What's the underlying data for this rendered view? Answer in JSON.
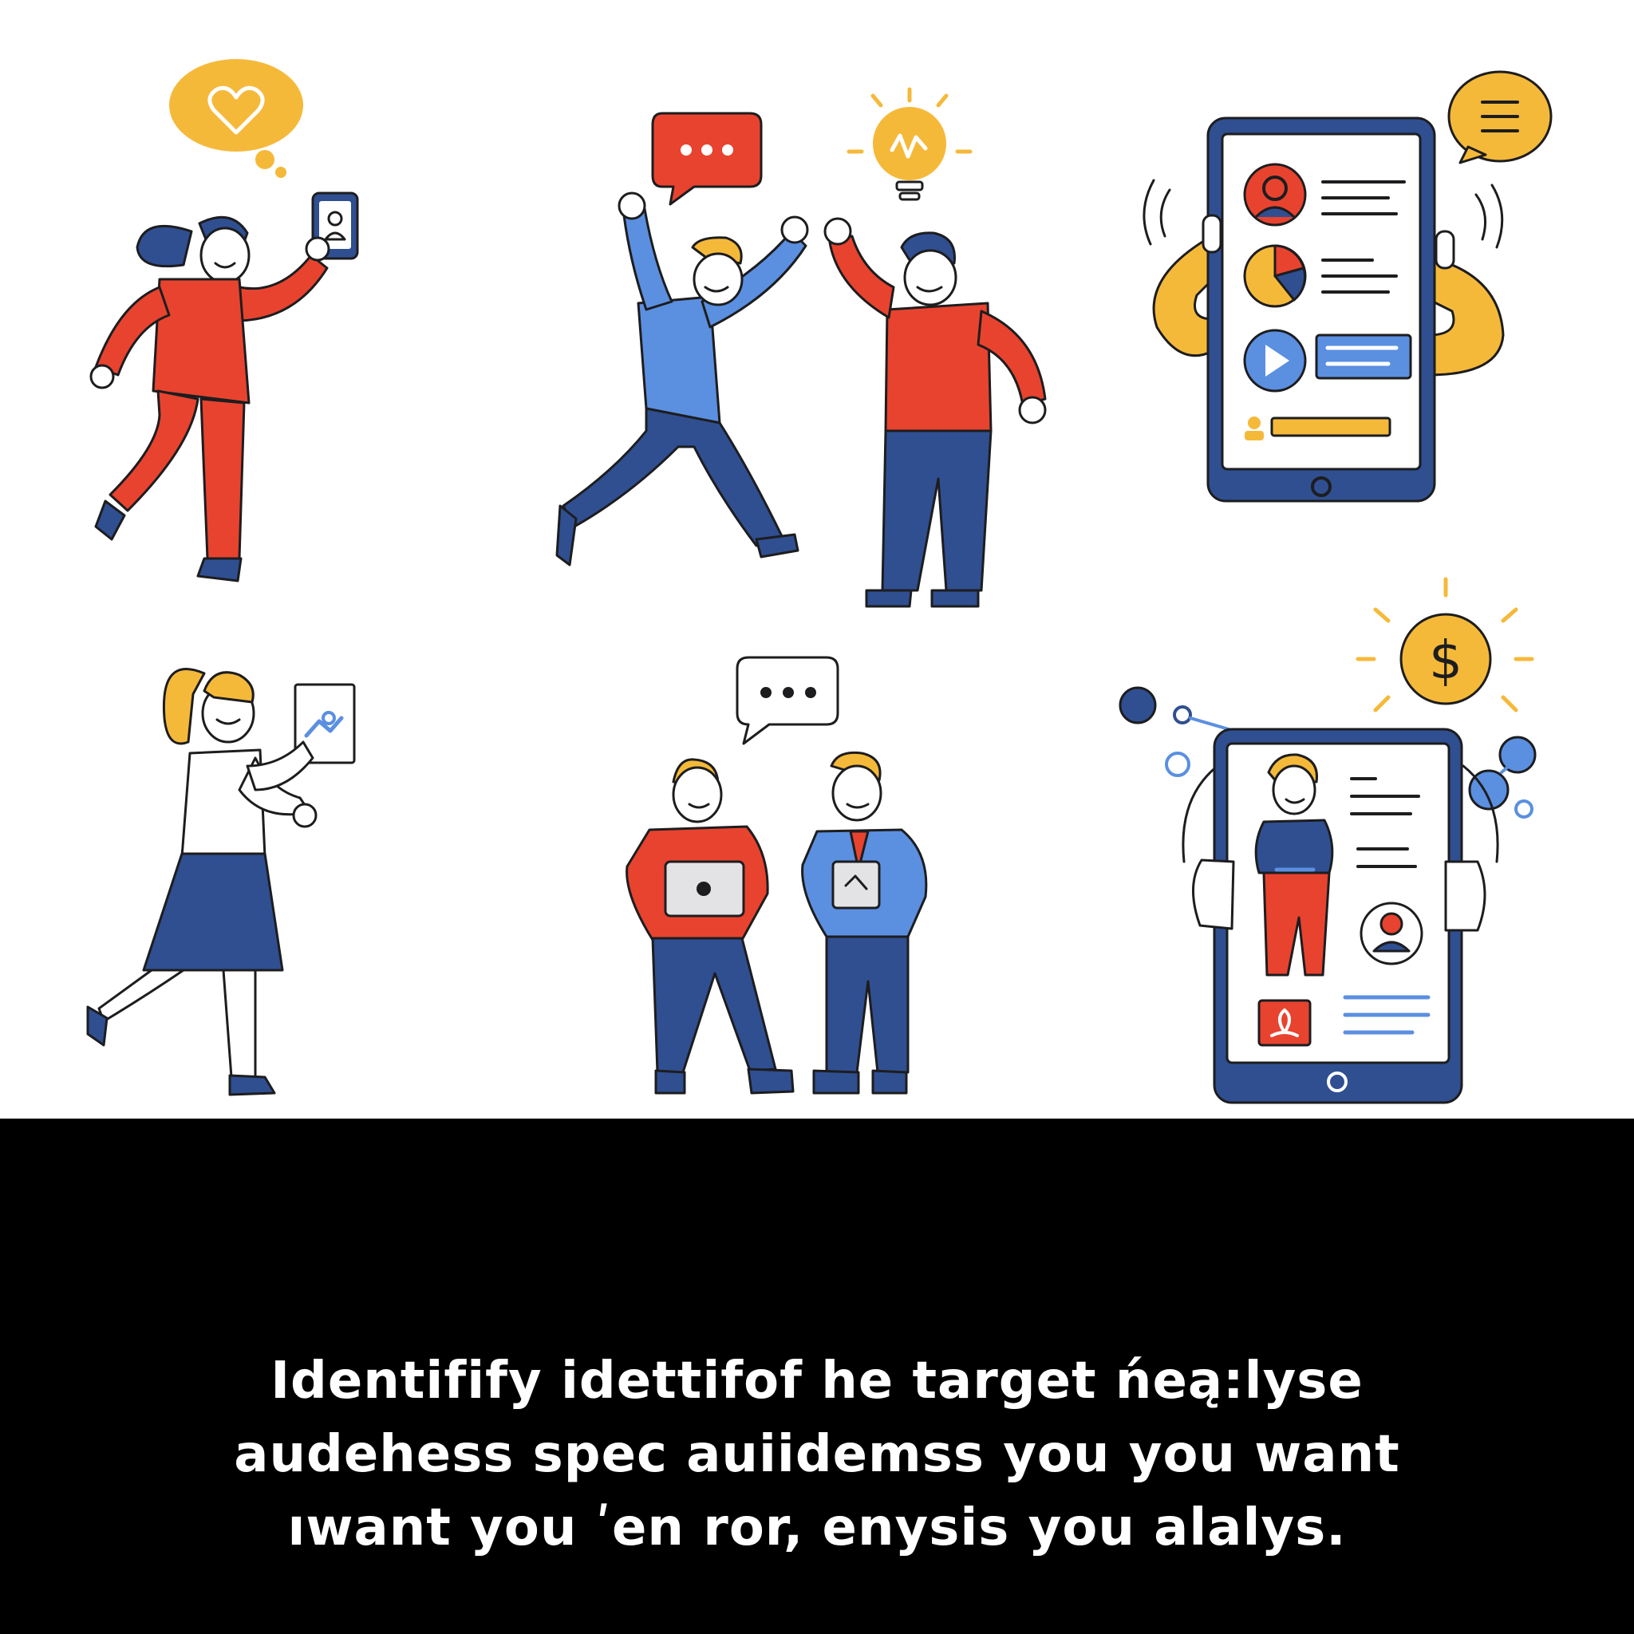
{
  "palette": {
    "red": "#e8432f",
    "blue": "#5b8fe0",
    "navy": "#2f4f91",
    "yellow": "#f5b93a",
    "outline": "#1d1d1f",
    "background": "#ffffff",
    "band": "#000000",
    "caption_text": "#ffffff"
  },
  "scenes": [
    {
      "name": "woman-holding-phone",
      "icons": [
        "heart-bubble-icon",
        "user-icon"
      ]
    },
    {
      "name": "two-men-celebrating",
      "icons": [
        "chat-dots-bubble-icon",
        "lightbulb-icon"
      ]
    },
    {
      "name": "hands-holding-tablet-profile",
      "icons": [
        "text-bubble-icon",
        "user-icon",
        "pie-chart-icon",
        "play-icon"
      ]
    },
    {
      "name": "woman-holding-document",
      "icons": [
        "analytics-icon"
      ]
    },
    {
      "name": "two-men-with-devices",
      "icons": [
        "chat-dots-bubble-icon",
        "laptop-icon",
        "tablet-icon"
      ]
    },
    {
      "name": "hands-holding-tablet-person",
      "icons": [
        "dollar-coin-icon",
        "network-nodes-icon",
        "user-icon"
      ]
    }
  ],
  "icons": {
    "dollar_symbol": "$",
    "chat_dots": "• • •"
  },
  "caption": {
    "line1": "Identifify idettifof he target ńeą:lyse",
    "line2": "audehess spec auiidemss you you want",
    "line3": "ıwant you ʹen ror, enysis you alalys."
  }
}
